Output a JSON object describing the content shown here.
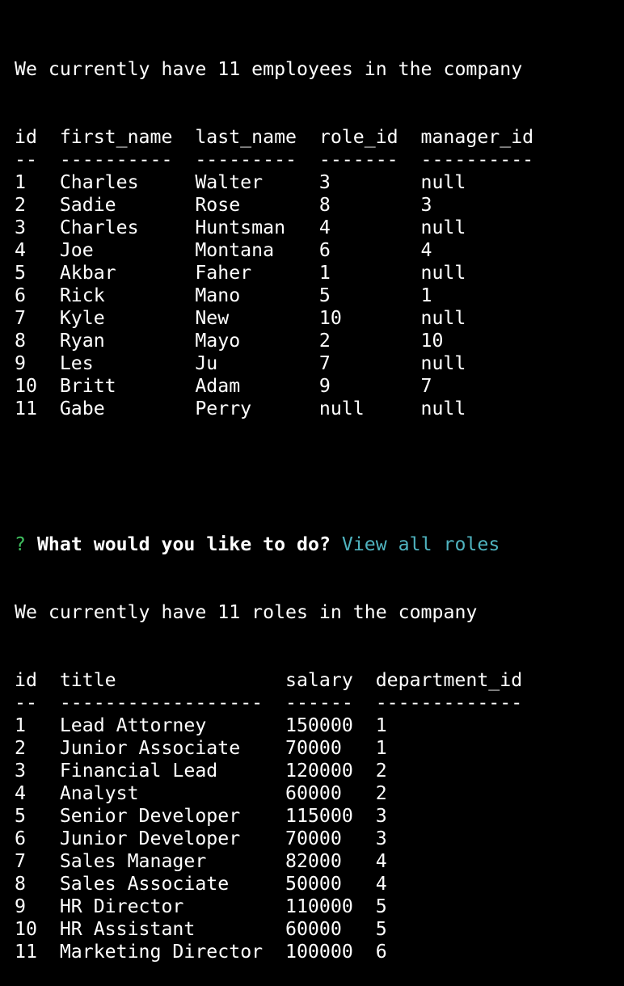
{
  "employees": {
    "summary": "We currently have 11 employees in the company",
    "headers": [
      "id",
      "first_name",
      "last_name",
      "role_id",
      "manager_id"
    ],
    "separators": [
      "--",
      "----------",
      "---------",
      "-------",
      "----------"
    ],
    "rows": [
      [
        "1",
        "Charles",
        "Walter",
        "3",
        "null"
      ],
      [
        "2",
        "Sadie",
        "Rose",
        "8",
        "3"
      ],
      [
        "3",
        "Charles",
        "Huntsman",
        "4",
        "null"
      ],
      [
        "4",
        "Joe",
        "Montana",
        "6",
        "4"
      ],
      [
        "5",
        "Akbar",
        "Faher",
        "1",
        "null"
      ],
      [
        "6",
        "Rick",
        "Mano",
        "5",
        "1"
      ],
      [
        "7",
        "Kyle",
        "New",
        "10",
        "null"
      ],
      [
        "8",
        "Ryan",
        "Mayo",
        "2",
        "10"
      ],
      [
        "9",
        "Les",
        "Ju",
        "7",
        "null"
      ],
      [
        "10",
        "Britt",
        "Adam",
        "9",
        "7"
      ],
      [
        "11",
        "Gabe",
        "Perry",
        "null",
        "null"
      ]
    ]
  },
  "prompt": {
    "marker": "?",
    "question": "What would you like to do?",
    "answer": "View all roles"
  },
  "roles": {
    "summary": "We currently have 11 roles in the company",
    "headers": [
      "id",
      "title",
      "salary",
      "department_id"
    ],
    "separators": [
      "--",
      "------------------",
      "------",
      "-------------"
    ],
    "rows": [
      [
        "1",
        "Lead Attorney",
        "150000",
        "1"
      ],
      [
        "2",
        "Junior Associate",
        "70000",
        "1"
      ],
      [
        "3",
        "Financial Lead",
        "120000",
        "2"
      ],
      [
        "4",
        "Analyst",
        "60000",
        "2"
      ],
      [
        "5",
        "Senior Developer",
        "115000",
        "3"
      ],
      [
        "6",
        "Junior Developer",
        "70000",
        "3"
      ],
      [
        "7",
        "Sales Manager",
        "82000",
        "4"
      ],
      [
        "8",
        "Sales Associate",
        "50000",
        "4"
      ],
      [
        "9",
        "HR Director",
        "110000",
        "5"
      ],
      [
        "10",
        "HR Assistant",
        "60000",
        "5"
      ],
      [
        "11",
        "Marketing Director",
        "100000",
        "6"
      ]
    ]
  },
  "colors": {
    "background": "#000000",
    "text": "#ffffff",
    "prompt_marker": "#3fbf5f",
    "prompt_answer": "#4fb3bf"
  }
}
